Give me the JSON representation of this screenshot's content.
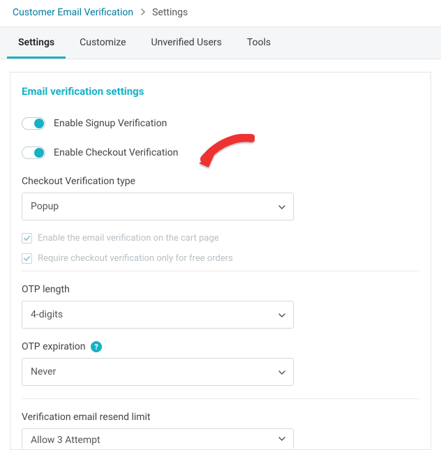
{
  "breadcrumb": {
    "root": "Customer Email Verification",
    "current": "Settings"
  },
  "tabs": [
    {
      "label": "Settings",
      "active": true
    },
    {
      "label": "Customize",
      "active": false
    },
    {
      "label": "Unverified Users",
      "active": false
    },
    {
      "label": "Tools",
      "active": false
    }
  ],
  "section_title": "Email verification settings",
  "toggles": {
    "signup": {
      "label": "Enable Signup Verification",
      "on": true
    },
    "checkout": {
      "label": "Enable Checkout Verification",
      "on": true
    }
  },
  "checkout_type": {
    "label": "Checkout Verification type",
    "value": "Popup"
  },
  "disabled_checks": {
    "cart_page": "Enable the email verification on the cart page",
    "free_orders": "Require checkout verification only for free orders"
  },
  "otp_length": {
    "label": "OTP length",
    "value": "4-digits"
  },
  "otp_expiration": {
    "label": "OTP expiration",
    "value": "Never"
  },
  "resend_limit": {
    "label": "Verification email resend limit",
    "value": "Allow 3 Attempt"
  },
  "help_glyph": "?"
}
